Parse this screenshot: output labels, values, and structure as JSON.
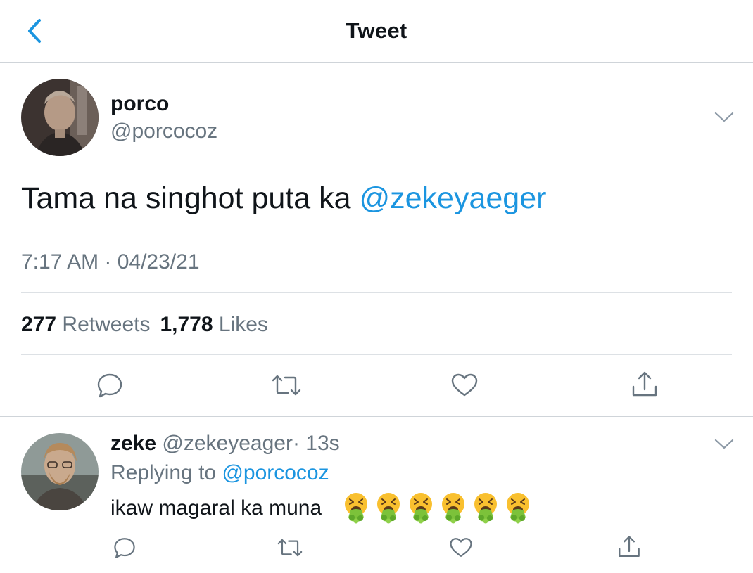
{
  "header": {
    "title": "Tweet"
  },
  "tweet": {
    "display_name": "porco",
    "handle": "@porcocoz",
    "text": "Tama na singhot puta ka ",
    "mention": "@zekeyaeger",
    "timestamp": "7:17 AM · 04/23/21",
    "retweet_count": "277",
    "retweet_label": "Retweets",
    "like_count": "1,778",
    "like_label": "Likes"
  },
  "reply": {
    "display_name": "zeke",
    "handle": "@zekeyeager",
    "time": "· 13s",
    "replying_label": "Replying to",
    "replying_to": "@porcocoz",
    "text": "ikaw magaral ka muna",
    "emojis": [
      "vomiting-face",
      "vomiting-face",
      "vomiting-face",
      "vomiting-face",
      "vomiting-face",
      "vomiting-face"
    ]
  },
  "icons": [
    "back-icon",
    "chevron-down-icon",
    "reply-icon",
    "retweet-icon",
    "like-icon",
    "share-icon"
  ],
  "colors": {
    "link": "#1b95e0",
    "muted": "#67747f",
    "text": "#0f1419",
    "divider": "#dde1e5"
  }
}
